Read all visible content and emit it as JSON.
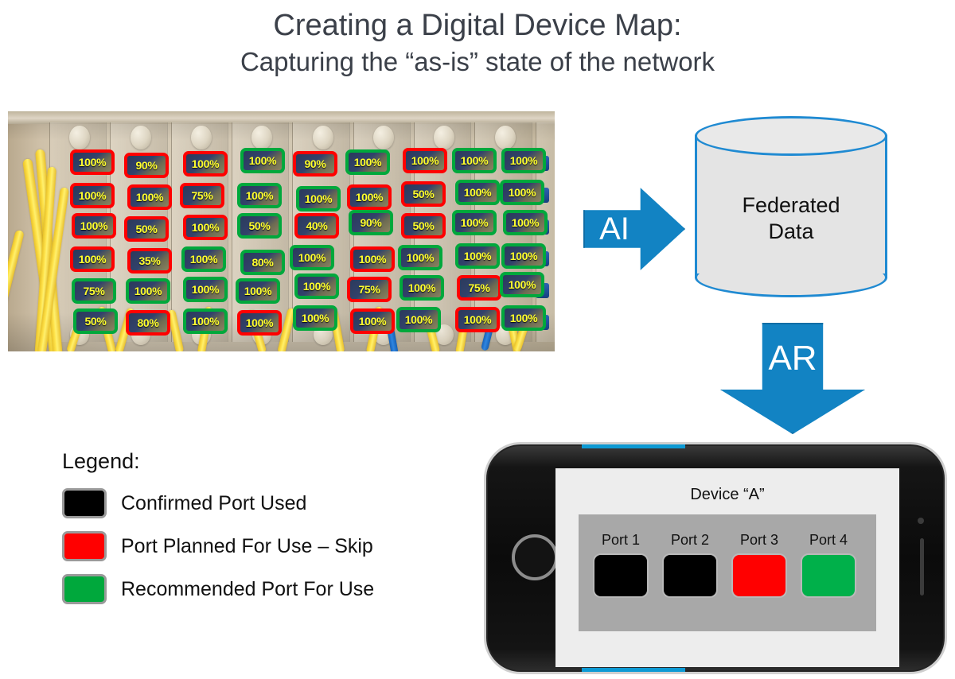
{
  "title": {
    "line1": "Creating a Digital Device Map:",
    "line2": "Capturing the “as-is” state of the network"
  },
  "flow": {
    "ai_arrow_label": "AI",
    "ar_arrow_label": "AR",
    "datastore_line1": "Federated",
    "datastore_line2": "Data",
    "arrow_color": "#1283c3",
    "datastore_stroke": "#1f8ad2",
    "datastore_fill": "#e4e4e4"
  },
  "panel_photo": {
    "columns": 9,
    "rows": 6,
    "status_colors": {
      "red": "#ff0000",
      "green": "#00a83c",
      "black": "#000000"
    },
    "ports": [
      [
        {
          "value": "100%",
          "status": "red"
        },
        {
          "value": "90%",
          "status": "red"
        },
        {
          "value": "100%",
          "status": "red"
        },
        {
          "value": "100%",
          "status": "green"
        },
        {
          "value": "90%",
          "status": "red"
        },
        {
          "value": "100%",
          "status": "green"
        },
        {
          "value": "100%",
          "status": "red"
        },
        {
          "value": "100%",
          "status": "green"
        },
        {
          "value": "100%",
          "status": "green"
        }
      ],
      [
        {
          "value": "100%",
          "status": "red"
        },
        {
          "value": "100%",
          "status": "red"
        },
        {
          "value": "75%",
          "status": "red"
        },
        {
          "value": "100%",
          "status": "green"
        },
        {
          "value": "100%",
          "status": "green"
        },
        {
          "value": "100%",
          "status": "red"
        },
        {
          "value": "50%",
          "status": "red"
        },
        {
          "value": "100%",
          "status": "green"
        },
        {
          "value": "100%",
          "status": "green"
        }
      ],
      [
        {
          "value": "100%",
          "status": "red"
        },
        {
          "value": "50%",
          "status": "red"
        },
        {
          "value": "100%",
          "status": "red"
        },
        {
          "value": "50%",
          "status": "green"
        },
        {
          "value": "40%",
          "status": "red"
        },
        {
          "value": "90%",
          "status": "green"
        },
        {
          "value": "50%",
          "status": "red"
        },
        {
          "value": "100%",
          "status": "green"
        },
        {
          "value": "100%",
          "status": "green"
        }
      ],
      [
        {
          "value": "100%",
          "status": "red"
        },
        {
          "value": "35%",
          "status": "red"
        },
        {
          "value": "100%",
          "status": "green"
        },
        {
          "value": "80%",
          "status": "green"
        },
        {
          "value": "100%",
          "status": "green"
        },
        {
          "value": "100%",
          "status": "red"
        },
        {
          "value": "100%",
          "status": "green"
        },
        {
          "value": "100%",
          "status": "green"
        },
        {
          "value": "100%",
          "status": "green"
        }
      ],
      [
        {
          "value": "75%",
          "status": "green"
        },
        {
          "value": "100%",
          "status": "green"
        },
        {
          "value": "100%",
          "status": "green"
        },
        {
          "value": "100%",
          "status": "green"
        },
        {
          "value": "100%",
          "status": "green"
        },
        {
          "value": "75%",
          "status": "red"
        },
        {
          "value": "100%",
          "status": "green"
        },
        {
          "value": "75%",
          "status": "red"
        },
        {
          "value": "100%",
          "status": "green"
        }
      ],
      [
        {
          "value": "50%",
          "status": "green"
        },
        {
          "value": "80%",
          "status": "red"
        },
        {
          "value": "100%",
          "status": "green"
        },
        {
          "value": "100%",
          "status": "red"
        },
        {
          "value": "100%",
          "status": "green"
        },
        {
          "value": "100%",
          "status": "red"
        },
        {
          "value": "100%",
          "status": "green"
        },
        {
          "value": "100%",
          "status": "red"
        },
        {
          "value": "100%",
          "status": "green"
        }
      ]
    ]
  },
  "legend": {
    "title": "Legend:",
    "items": [
      {
        "color": "#000000",
        "label": "Confirmed Port Used"
      },
      {
        "color": "#ff0000",
        "label": "Port Planned For Use – Skip"
      },
      {
        "color": "#00a83c",
        "label": "Recommended Port For Use"
      }
    ]
  },
  "phone": {
    "device_title": "Device “A”",
    "ports": [
      {
        "label": "Port 1",
        "color": "#000000"
      },
      {
        "label": "Port 2",
        "color": "#000000"
      },
      {
        "label": "Port 3",
        "color": "#ff0000"
      },
      {
        "label": "Port 4",
        "color": "#00b04a"
      }
    ]
  }
}
